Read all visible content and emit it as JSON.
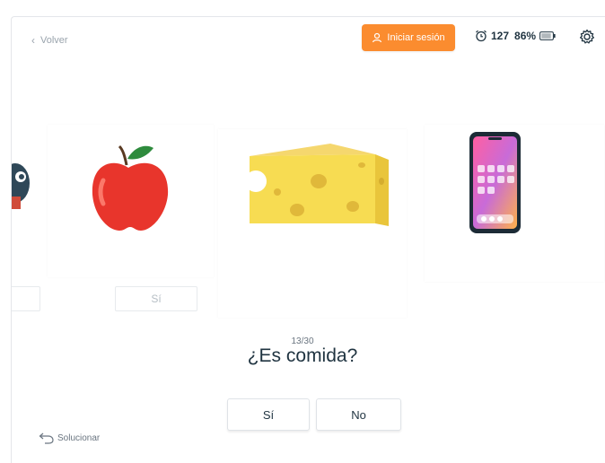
{
  "header": {
    "back_label": "Volver",
    "login_label": "Iniciar sesión",
    "timer_value": "127",
    "battery_percent": "86%",
    "icons": [
      "chevron-left-icon",
      "user-icon",
      "alarm-clock-icon",
      "battery-icon",
      "gear-icon"
    ],
    "accent_color": "#fb8c2f"
  },
  "carousel": {
    "cards": [
      {
        "image": "partial-image"
      },
      {
        "image": "apple",
        "answer_label": "Sí"
      },
      {
        "image": "cheese"
      },
      {
        "image": "smartphone"
      }
    ]
  },
  "quiz": {
    "counter": "13/30",
    "question": "¿Es comida?",
    "yes_label": "Sí",
    "no_label": "No"
  },
  "footer": {
    "solve_label": "Solucionar",
    "icon": "undo-arrow-icon"
  }
}
